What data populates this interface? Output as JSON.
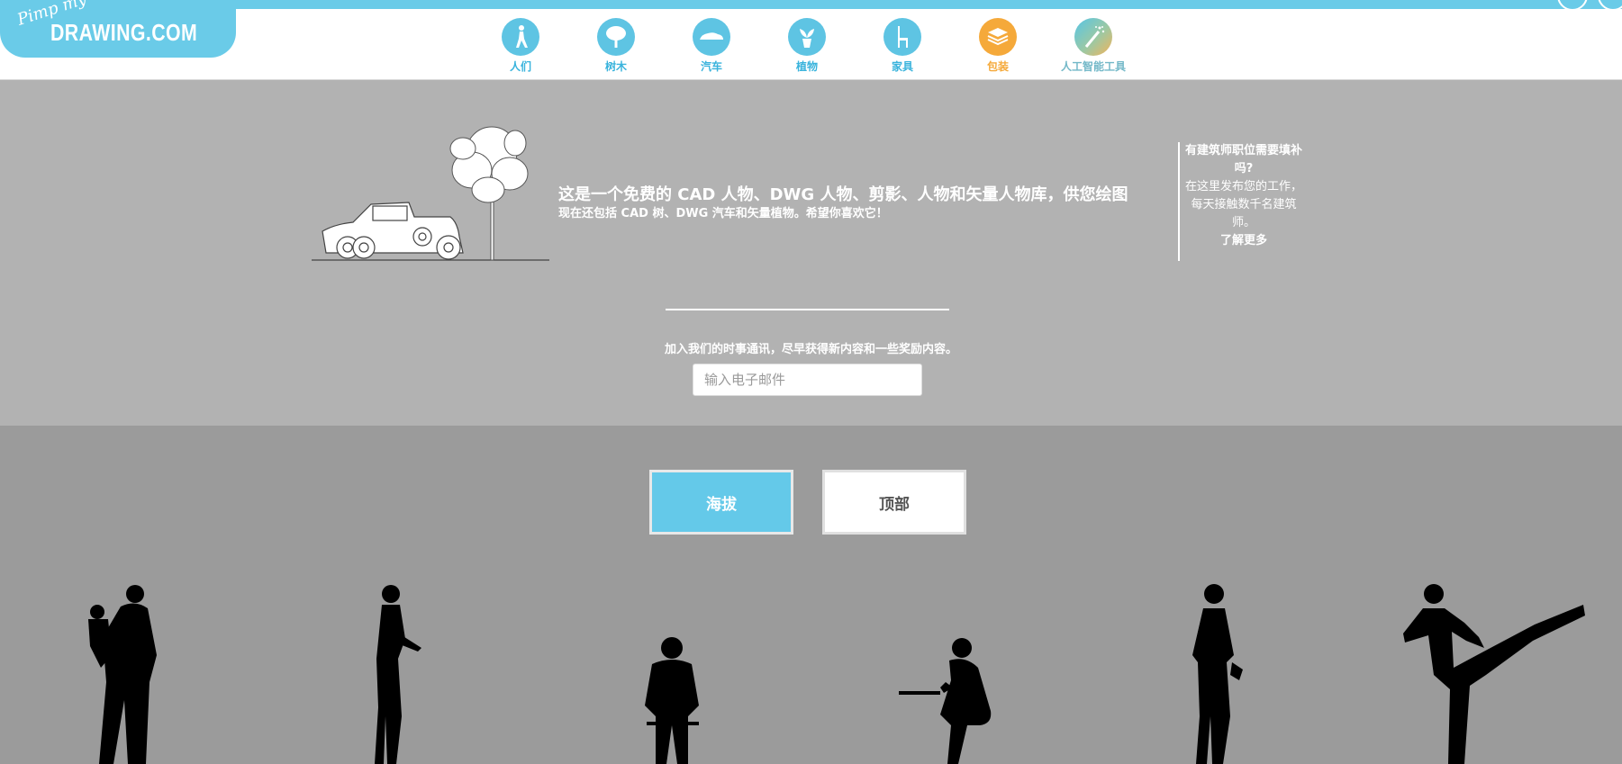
{
  "logo": {
    "tagline": "Pimp my",
    "name": "DRAWING.COM"
  },
  "nav": {
    "items": [
      {
        "label": "人们",
        "icon": "person-walking-icon"
      },
      {
        "label": "树木",
        "icon": "tree-icon"
      },
      {
        "label": "汽车",
        "icon": "car-icon"
      },
      {
        "label": "植物",
        "icon": "potted-plant-icon"
      },
      {
        "label": "家具",
        "icon": "chair-icon"
      },
      {
        "label": "包装",
        "icon": "layers-stack-icon",
        "active": true
      },
      {
        "label": "人工智能工具",
        "icon": "magic-wand-icon"
      }
    ]
  },
  "hero": {
    "headline": "这是一个免费的 CAD 人物、DWG 人物、剪影、人物和矢量人物库，供您绘图",
    "subline": "现在还包括 CAD 树、DWG 汽车和矢量植物。希望你喜欢它！"
  },
  "sidead": {
    "question": "有建筑师职位需要填补吗?",
    "body": "在这里发布您的工作，每天接触数千名建筑师。",
    "link": "了解更多"
  },
  "newsletter": {
    "text": "加入我们的时事通讯，尽早获得新内容和一些奖励内容。",
    "placeholder": "输入电子邮件"
  },
  "view_buttons": {
    "elevation": "海拔",
    "top": "顶部"
  },
  "colors": {
    "accent": "#6acbe8",
    "active": "#f5a93a",
    "hero_bg": "#b2b2b2",
    "body_bg": "#9b9b9b"
  }
}
